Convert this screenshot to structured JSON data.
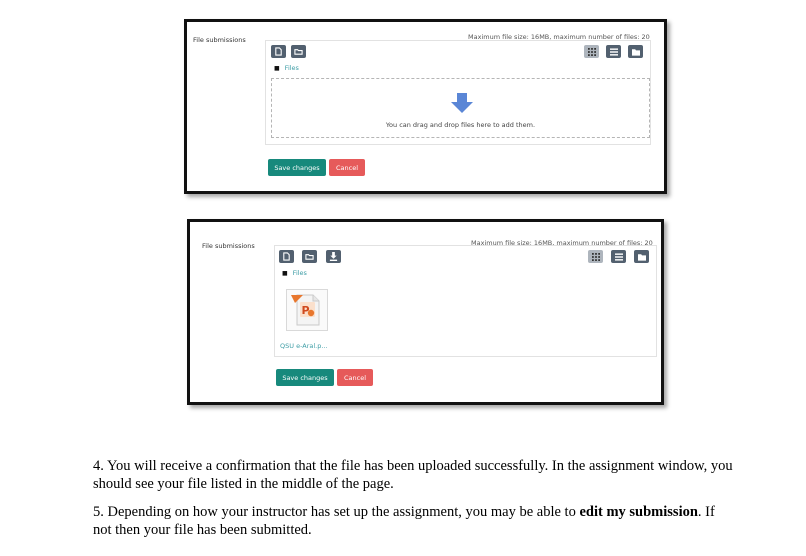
{
  "screenshot1": {
    "section_label": "File submissions",
    "max_info": "Maximum file size: 16MB, maximum number of files: 20",
    "path_label": "Files",
    "drop_message": "You can drag and drop files here to add them.",
    "save_label": "Save changes",
    "cancel_label": "Cancel",
    "toolbar_left_icons": [
      "add-file-icon",
      "create-folder-icon"
    ],
    "view_icons": [
      "grid-view-icon",
      "list-view-icon",
      "tree-view-icon"
    ]
  },
  "screenshot2": {
    "section_label": "File submissions",
    "max_info": "Maximum file size: 16MB, maximum number of files: 20",
    "path_label": "Files",
    "file_name": "QSU e-Aral.p...",
    "save_label": "Save changes",
    "cancel_label": "Cancel",
    "toolbar_left_icons": [
      "add-file-icon",
      "create-folder-icon",
      "download-icon"
    ],
    "view_icons": [
      "grid-view-icon",
      "list-view-icon",
      "tree-view-icon"
    ]
  },
  "instructions": {
    "step4": "4. You will receive a confirmation that the file has been uploaded successfully. In the assignment window, you should see your file listed in the middle of the page.",
    "step5_pre": "5. Depending on how your instructor has set up the assignment, you may be able to ",
    "step5_bold": "edit my submission",
    "step5_post": ". If not then your file has been submitted."
  },
  "colors": {
    "save": "#17897c",
    "cancel": "#e65a5a",
    "toolbar": "#52606f",
    "link": "#3f9ea6",
    "arrow": "#5a86d6"
  }
}
